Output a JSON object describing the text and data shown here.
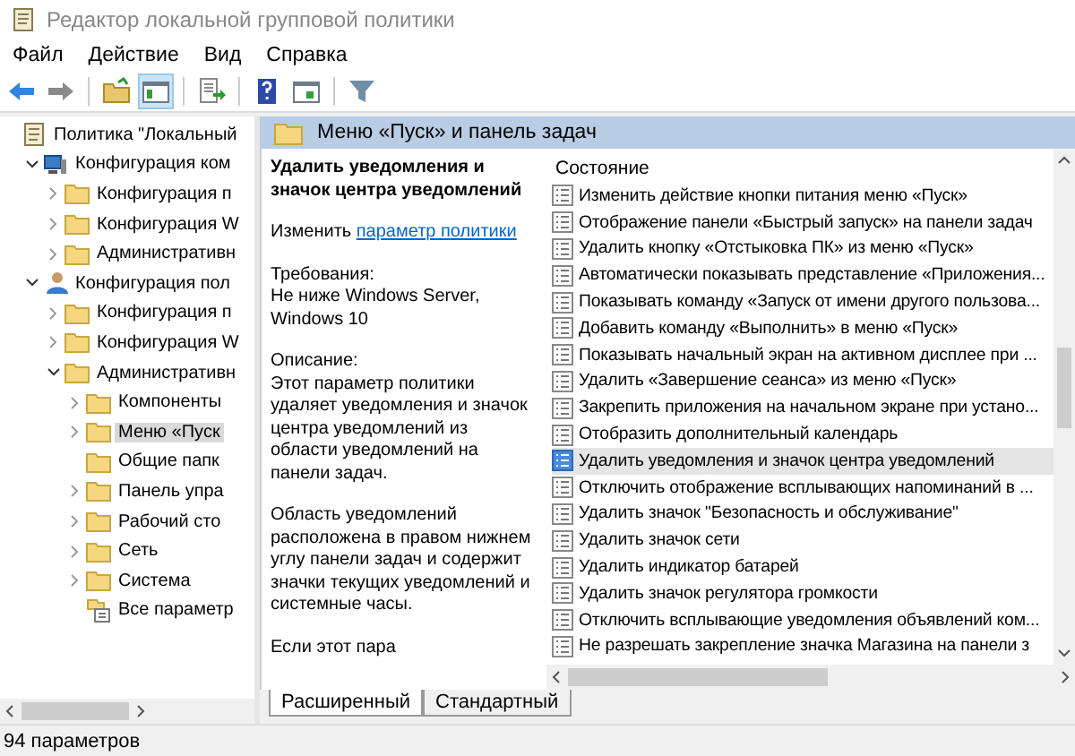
{
  "window": {
    "title": "Редактор локальной групповой политики"
  },
  "menu": [
    "Файл",
    "Действие",
    "Вид",
    "Справка"
  ],
  "toolbar": [
    {
      "kind": "back",
      "pressed": false
    },
    {
      "kind": "forward",
      "pressed": false
    },
    {
      "kind": "sep"
    },
    {
      "kind": "up",
      "pressed": false
    },
    {
      "kind": "tree",
      "pressed": true
    },
    {
      "kind": "sep"
    },
    {
      "kind": "export",
      "pressed": false
    },
    {
      "kind": "sep"
    },
    {
      "kind": "help",
      "pressed": false
    },
    {
      "kind": "props",
      "pressed": false
    },
    {
      "kind": "sep"
    },
    {
      "kind": "filter",
      "pressed": false
    }
  ],
  "tree": {
    "items": [
      {
        "label": "Политика \"Локальный",
        "kind": "policy",
        "selected": false,
        "children": [
          {
            "label": "Конфигурация ком",
            "kind": "computer",
            "selected": false,
            "expanded": true,
            "children": [
              {
                "label": "Конфигурация п",
                "kind": "folder",
                "selected": false,
                "expanded": false
              },
              {
                "label": "Конфигурация W",
                "kind": "folder",
                "selected": false,
                "expanded": false
              },
              {
                "label": "Административн",
                "kind": "folder",
                "selected": false,
                "expanded": false
              }
            ]
          },
          {
            "label": "Конфигурация пол",
            "kind": "user",
            "selected": false,
            "expanded": true,
            "children": [
              {
                "label": "Конфигурация п",
                "kind": "folder",
                "selected": false,
                "expanded": false
              },
              {
                "label": "Конфигурация W",
                "kind": "folder",
                "selected": false,
                "expanded": false
              },
              {
                "label": "Административн",
                "kind": "folder",
                "selected": false,
                "expanded": true,
                "children": [
                  {
                    "label": "Компоненты",
                    "kind": "folder",
                    "selected": false,
                    "expanded": false
                  },
                  {
                    "label": "Меню «Пуск",
                    "kind": "folder",
                    "selected": true,
                    "expanded": false
                  },
                  {
                    "label": "Общие папк",
                    "kind": "folder",
                    "selected": false
                  },
                  {
                    "label": "Панель упра",
                    "kind": "folder",
                    "selected": false,
                    "expanded": false
                  },
                  {
                    "label": "Рабочий сто",
                    "kind": "folder",
                    "selected": false,
                    "expanded": false
                  },
                  {
                    "label": "Сеть",
                    "kind": "folder",
                    "selected": false,
                    "expanded": false
                  },
                  {
                    "label": "Система",
                    "kind": "folder",
                    "selected": false,
                    "expanded": false
                  },
                  {
                    "label": "Все параметр",
                    "kind": "settings",
                    "selected": false
                  }
                ]
              }
            ]
          }
        ]
      }
    ]
  },
  "pane": {
    "header": "Меню «Пуск» и панель задач",
    "description": {
      "title": "Удалить уведомления и значок центра уведомлений",
      "edit_prefix": "Изменить",
      "edit_link": "параметр политики",
      "requirements_label": "Требования:",
      "requirements": "Не ниже Windows Server, Windows 10",
      "description_label": "Описание:",
      "paragraphs": [
        "Этот параметр политики удаляет уведомления и значок центра уведомлений из области уведомлений на панели задач.",
        "Область уведомлений расположена в правом нижнем углу панели задач и содержит значки текущих уведомлений и системные часы.",
        "Если этот пара"
      ]
    },
    "list": {
      "column": "Состояние",
      "rows": [
        {
          "text": "Изменить действие кнопки питания меню «Пуск»",
          "selected": false
        },
        {
          "text": "Отображение панели «Быстрый запуск» на панели задач",
          "selected": false
        },
        {
          "text": "Удалить кнопку «Отстыковка ПК» из меню «Пуск»",
          "selected": false
        },
        {
          "text": "Автоматически показывать представление «Приложения...",
          "selected": false
        },
        {
          "text": "Показывать команду «Запуск от имени другого пользова...",
          "selected": false
        },
        {
          "text": "Добавить команду «Выполнить» в меню «Пуск»",
          "selected": false
        },
        {
          "text": "Показывать начальный экран на активном дисплее при ...",
          "selected": false
        },
        {
          "text": "Удалить «Завершение сеанса» из меню «Пуск»",
          "selected": false
        },
        {
          "text": "Закрепить приложения на начальном экране при устано...",
          "selected": false
        },
        {
          "text": "Отобразить дополнительный календарь",
          "selected": false
        },
        {
          "text": "Удалить уведомления и значок центра уведомлений",
          "selected": true
        },
        {
          "text": "Отключить отображение всплывающих напоминаний в ...",
          "selected": false
        },
        {
          "text": "Удалить значок \"Безопасность и обслуживание\"",
          "selected": false
        },
        {
          "text": "Удалить значок сети",
          "selected": false
        },
        {
          "text": "Удалить индикатор батарей",
          "selected": false
        },
        {
          "text": "Удалить значок регулятора громкости",
          "selected": false
        },
        {
          "text": "Отключить всплывающие уведомления объявлений ком...",
          "selected": false
        },
        {
          "text": "Не разрешать закрепление значка Магазина на панели з",
          "selected": false
        }
      ]
    },
    "tabs": [
      {
        "label": "Расширенный",
        "selected": true
      },
      {
        "label": "Стандартный",
        "selected": false
      }
    ]
  },
  "status_bar": "94 параметров"
}
